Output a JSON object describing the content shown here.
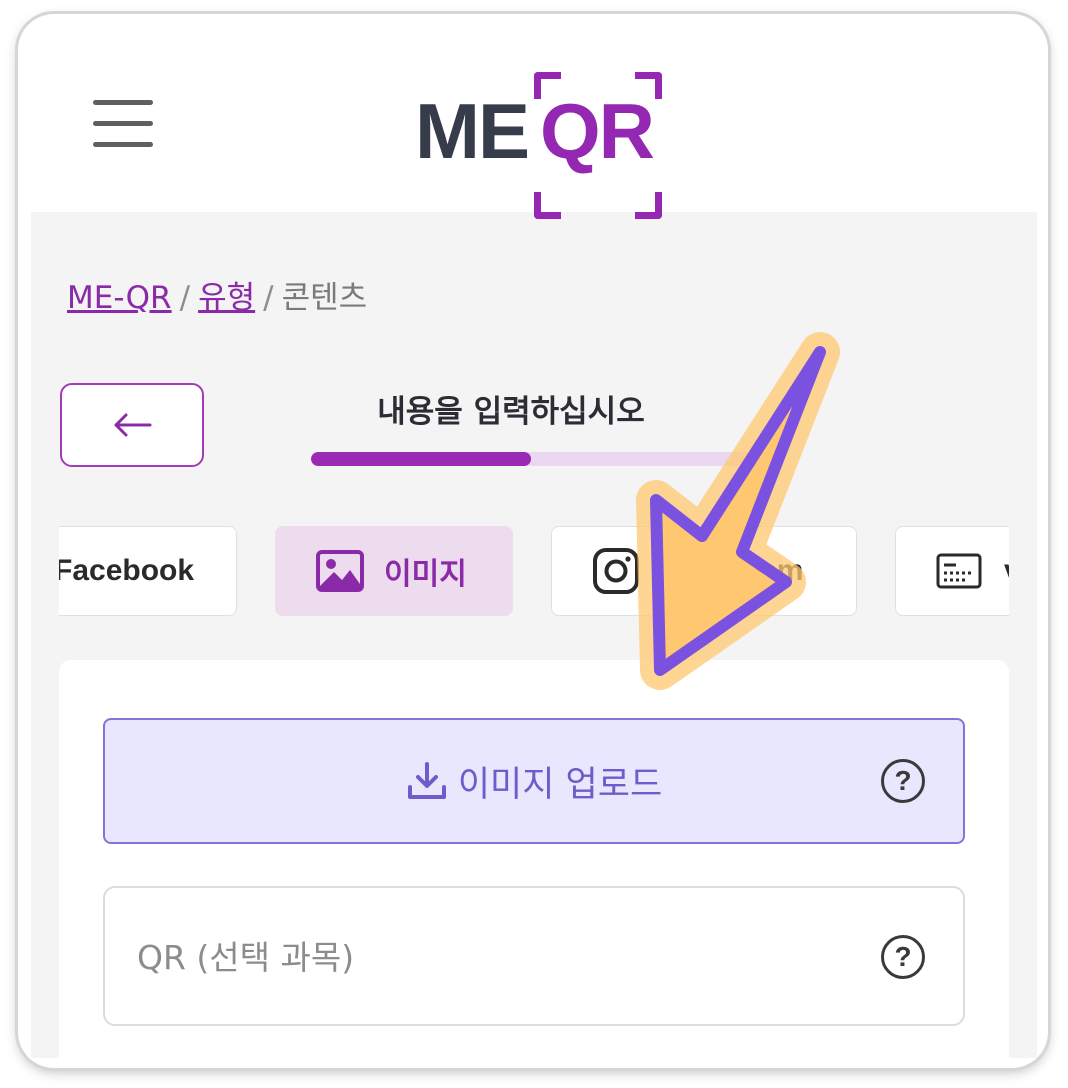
{
  "header": {
    "logo": {
      "part1": "ME",
      "part2": "QR"
    }
  },
  "breadcrumb": {
    "items": [
      "ME-QR",
      "유형",
      "콘텐츠"
    ],
    "separator": "/"
  },
  "step": {
    "title": "내용을 입력하십시오",
    "progress": 0.5
  },
  "tabs": [
    {
      "label": "Facebook",
      "icon": "facebook"
    },
    {
      "label": "이미지",
      "icon": "image-icon",
      "active": true
    },
    {
      "label": "Instagram",
      "icon": "instagram-icon"
    },
    {
      "label": "vCard",
      "icon": "vcard-icon"
    }
  ],
  "form": {
    "upload_label": "이미지 업로드",
    "qr_placeholder": "QR (선택 과목)",
    "help_symbol": "?"
  },
  "colors": {
    "brand_purple": "#9428b2",
    "upload_bg": "#e9e7fd",
    "upload_accent": "#6d5cc9",
    "annotation_arrow_fill": "#ffc870",
    "annotation_arrow_stroke": "#7b52e0"
  }
}
